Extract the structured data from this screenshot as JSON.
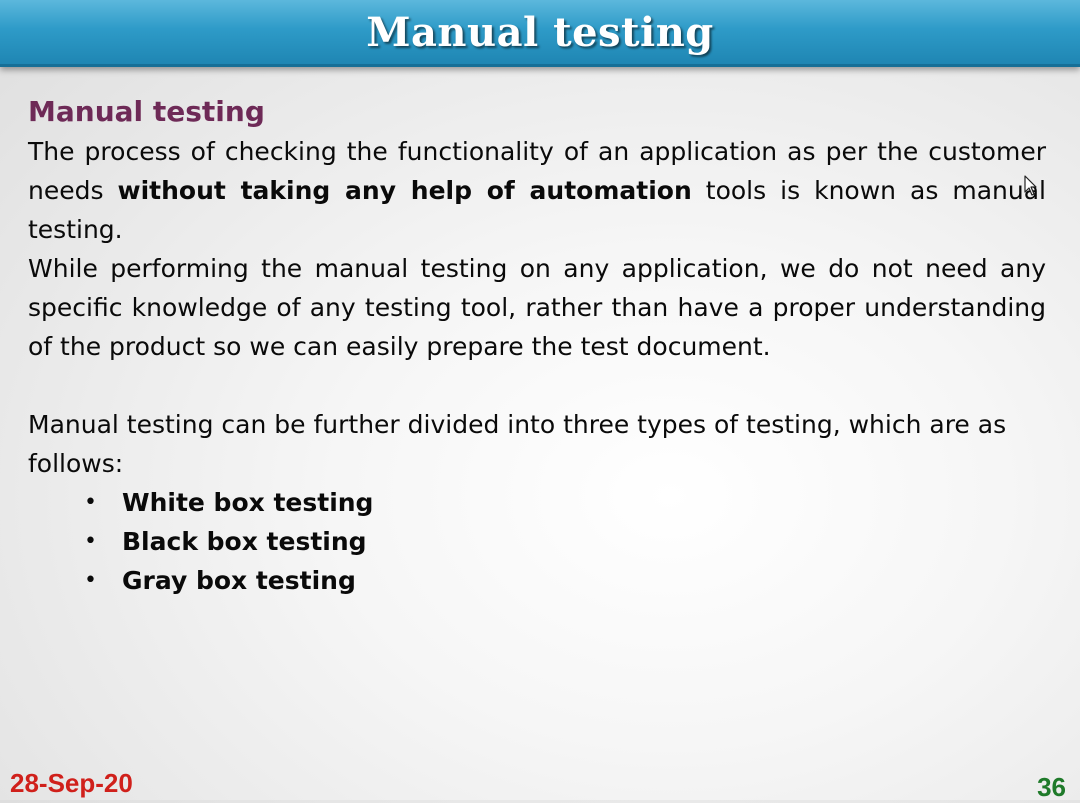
{
  "slide": {
    "title": "Manual testing",
    "heading": "Manual testing",
    "para1": {
      "before": "The process of checking the functionality of an application as per the customer needs ",
      "bold": "without taking any help of automation",
      "after": " tools is known as manual testing."
    },
    "para2": "While performing the manual testing on any application, we do not need any specific knowledge of any testing tool, rather than have a proper understanding of the product so we can easily prepare the test document.",
    "para3": "Manual testing can be further divided into three types of testing, which are as follows:",
    "bullets": [
      "White box testing",
      "Black box testing",
      "Gray box testing"
    ],
    "bullet_symbol": "•"
  },
  "footer": {
    "date": "28-Sep-20",
    "page_number": "36"
  },
  "colors": {
    "title_bar": "#2e9bc8",
    "heading": "#6e2a57",
    "date": "#d0201b",
    "page_number": "#1f7a2a"
  },
  "icons": {
    "cursor": "mouse-pointer-icon"
  }
}
